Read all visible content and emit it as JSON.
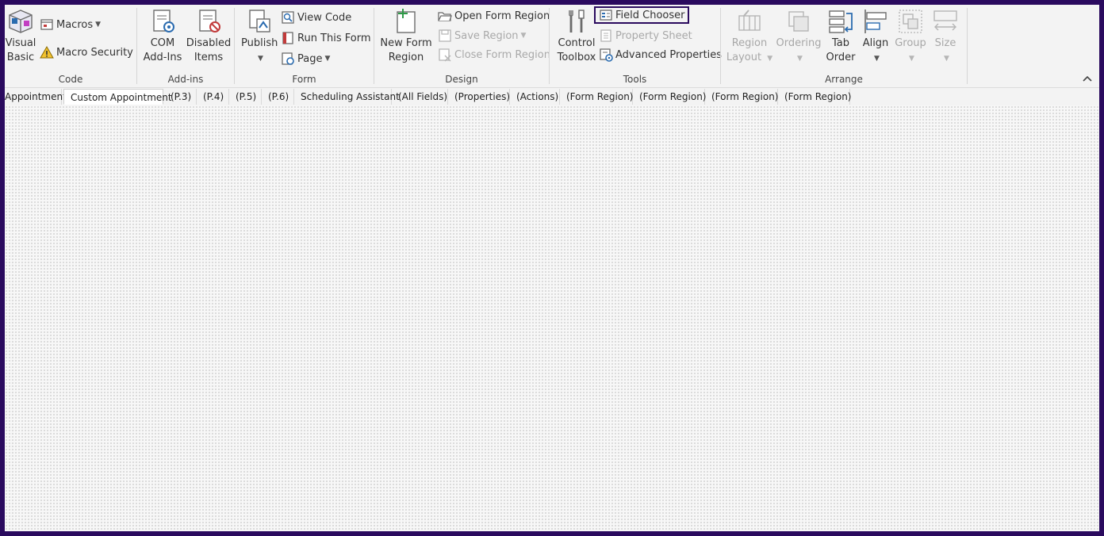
{
  "colors": {
    "accent": "#2a0a5e",
    "blue": "#2b6cb0",
    "icon_gray": "#6b6b6b",
    "disabled": "#b5b5b5"
  },
  "ribbon": {
    "code": {
      "label": "Code",
      "visual_basic": "Visual Basic",
      "visual_basic_l1": "Visual",
      "visual_basic_l2": "Basic",
      "macros": "Macros",
      "macro_security": "Macro Security"
    },
    "addins": {
      "label": "Add-ins",
      "com_l1": "COM",
      "com_l2": "Add-Ins",
      "disabled_l1": "Disabled",
      "disabled_l2": "Items"
    },
    "form": {
      "label": "Form",
      "publish": "Publish",
      "view_code": "View Code",
      "run_this_form": "Run This Form",
      "page": "Page"
    },
    "design": {
      "label": "Design",
      "new_form_region_l1": "New Form",
      "new_form_region_l2": "Region",
      "open_form_region": "Open Form Region",
      "save_region": "Save Region",
      "close_form_region": "Close Form Region"
    },
    "tools": {
      "label": "Tools",
      "control_toolbox_l1": "Control",
      "control_toolbox_l2": "Toolbox",
      "field_chooser": "Field Chooser",
      "property_sheet": "Property Sheet",
      "advanced_properties": "Advanced Properties"
    },
    "arrange": {
      "label": "Arrange",
      "region_layout_l1": "Region",
      "region_layout_l2": "Layout",
      "ordering": "Ordering",
      "tab_order_l1": "Tab",
      "tab_order_l2": "Order",
      "align": "Align",
      "group": "Group",
      "size": "Size"
    }
  },
  "tabs": [
    {
      "label": "Appointment"
    },
    {
      "label": "Custom Appointment"
    },
    {
      "label": "(P.3)"
    },
    {
      "label": "(P.4)"
    },
    {
      "label": "(P.5)"
    },
    {
      "label": "(P.6)"
    },
    {
      "label": "Scheduling Assistant"
    },
    {
      "label": "(All Fields)"
    },
    {
      "label": "(Properties)"
    },
    {
      "label": "(Actions)"
    },
    {
      "label": "(Form Region)"
    },
    {
      "label": "(Form Region)"
    },
    {
      "label": "(Form Region)"
    },
    {
      "label": "(Form Region)"
    }
  ]
}
